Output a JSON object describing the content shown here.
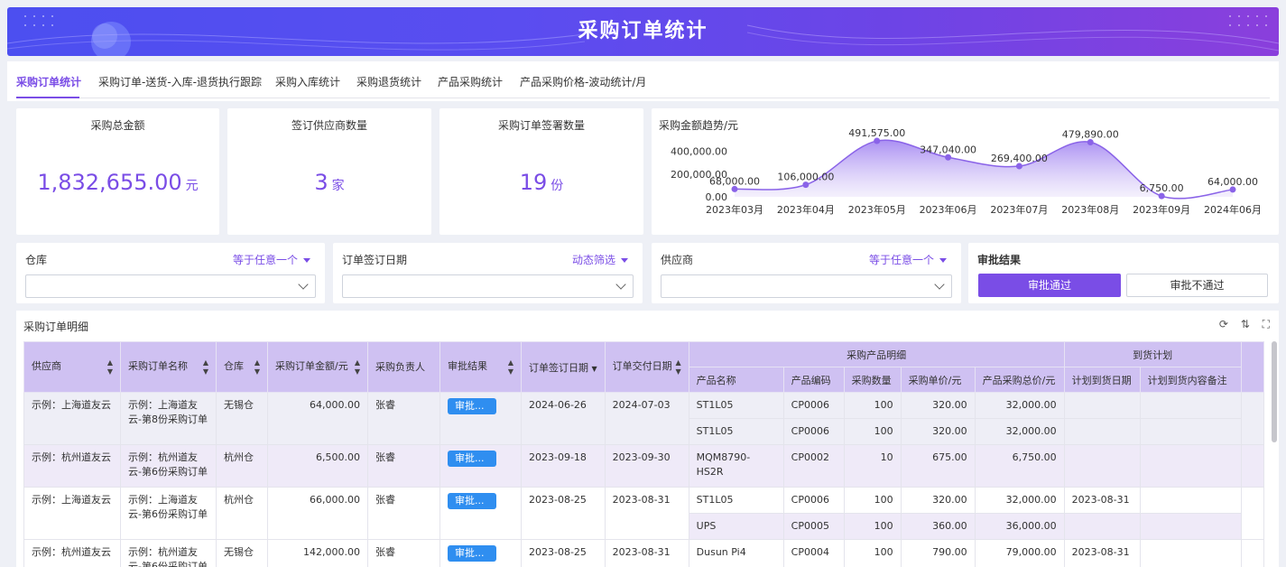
{
  "header": {
    "title": "采购订单统计"
  },
  "tabs": [
    {
      "label": "采购订单统计"
    },
    {
      "label": "采购订单-送货-入库-退货执行跟踪"
    },
    {
      "label": "采购入库统计"
    },
    {
      "label": "采购退货统计"
    },
    {
      "label": "产品采购统计"
    },
    {
      "label": "产品采购价格-波动统计/月"
    }
  ],
  "kpis": [
    {
      "title": "采购总金额",
      "value": "1,832,655.00",
      "unit": "元"
    },
    {
      "title": "签订供应商数量",
      "value": "3",
      "unit": "家"
    },
    {
      "title": "采购订单签署数量",
      "value": "19",
      "unit": "份"
    }
  ],
  "chart_data": {
    "type": "area",
    "title": "采购金额趋势/元",
    "categories": [
      "2023年03月",
      "2023年04月",
      "2023年05月",
      "2023年06月",
      "2023年07月",
      "2023年08月",
      "2023年09月",
      "2024年06月"
    ],
    "values": [
      68000,
      106000,
      491575,
      347040,
      269400,
      479890,
      6750,
      64000
    ],
    "labels": [
      "68,000.00",
      "106,000.00",
      "491,575.00",
      "347,040.00",
      "269,400.00",
      "479,890.00",
      "6,750.00",
      "64,000.00"
    ],
    "yticks": [
      "400,000.00",
      "200,000.00",
      "0.00"
    ],
    "ylim": [
      0,
      500000
    ],
    "grid": false,
    "color": "#8a63e8"
  },
  "filters": {
    "warehouse": {
      "label": "仓库",
      "op": "等于任意一个"
    },
    "date": {
      "label": "订单签订日期",
      "op": "动态筛选"
    },
    "supplier": {
      "label": "供应商",
      "op": "等于任意一个"
    },
    "approval": {
      "label": "审批结果",
      "pass": "审批通过",
      "fail": "审批不通过"
    }
  },
  "table": {
    "title": "采购订单明细",
    "headers": {
      "supplier": "供应商",
      "order_name": "采购订单名称",
      "warehouse": "仓库",
      "amount": "采购订单金额/元",
      "owner": "采购负责人",
      "approval": "审批结果",
      "sign_date": "订单签订日期",
      "delivery_date": "订单交付日期",
      "product_group": "采购产品明细",
      "product_name": "产品名称",
      "product_code": "产品编码",
      "qty": "采购数量",
      "unit_price": "采购单价/元",
      "total": "产品采购总价/元",
      "arrival_group": "到货计划",
      "plan_date": "计划到货日期",
      "plan_note": "计划到货内容备注"
    },
    "orders": [
      {
        "supplier": "示例：上海道友云",
        "order_name": "示例：上海道友云-第8份采购订单",
        "warehouse": "无锡仓",
        "amount": "64,000.00",
        "owner": "张睿",
        "approval": "审批...",
        "sign_date": "2024-06-26",
        "delivery_date": "2024-07-03",
        "items": [
          {
            "name": "ST1L05",
            "code": "CP0006",
            "qty": "100",
            "price": "320.00",
            "total": "32,000.00",
            "plan_date": "",
            "note": ""
          },
          {
            "name": "ST1L05",
            "code": "CP0006",
            "qty": "100",
            "price": "320.00",
            "total": "32,000.00",
            "plan_date": "",
            "note": ""
          }
        ]
      },
      {
        "supplier": "示例：杭州道友云",
        "order_name": "示例：杭州道友云-第6份采购订单",
        "warehouse": "杭州仓",
        "amount": "6,500.00",
        "owner": "张睿",
        "approval": "审批...",
        "sign_date": "2023-09-18",
        "delivery_date": "2023-09-30",
        "items": [
          {
            "name": "MQM8790-HS2R",
            "code": "CP0002",
            "qty": "10",
            "price": "675.00",
            "total": "6,750.00",
            "plan_date": "",
            "note": ""
          }
        ]
      },
      {
        "supplier": "示例：上海道友云",
        "order_name": "示例：上海道友云-第6份采购订单",
        "warehouse": "杭州仓",
        "amount": "66,000.00",
        "owner": "张睿",
        "approval": "审批...",
        "sign_date": "2023-08-25",
        "delivery_date": "2023-08-31",
        "items": [
          {
            "name": "ST1L05",
            "code": "CP0006",
            "qty": "100",
            "price": "320.00",
            "total": "32,000.00",
            "plan_date": "2023-08-31",
            "note": ""
          },
          {
            "name": "UPS",
            "code": "CP0005",
            "qty": "100",
            "price": "360.00",
            "total": "36,000.00",
            "plan_date": "",
            "note": ""
          }
        ]
      },
      {
        "supplier": "示例：杭州道友云",
        "order_name": "示例：杭州道友云-第6份采购订单",
        "warehouse": "无锡仓",
        "amount": "142,000.00",
        "owner": "张睿",
        "approval": "审批...",
        "sign_date": "2023-08-25",
        "delivery_date": "2023-08-31",
        "items": [
          {
            "name": "Dusun Pi4",
            "code": "CP0004",
            "qty": "100",
            "price": "790.00",
            "total": "79,000.00",
            "plan_date": "2023-08-31",
            "note": ""
          }
        ]
      }
    ]
  }
}
